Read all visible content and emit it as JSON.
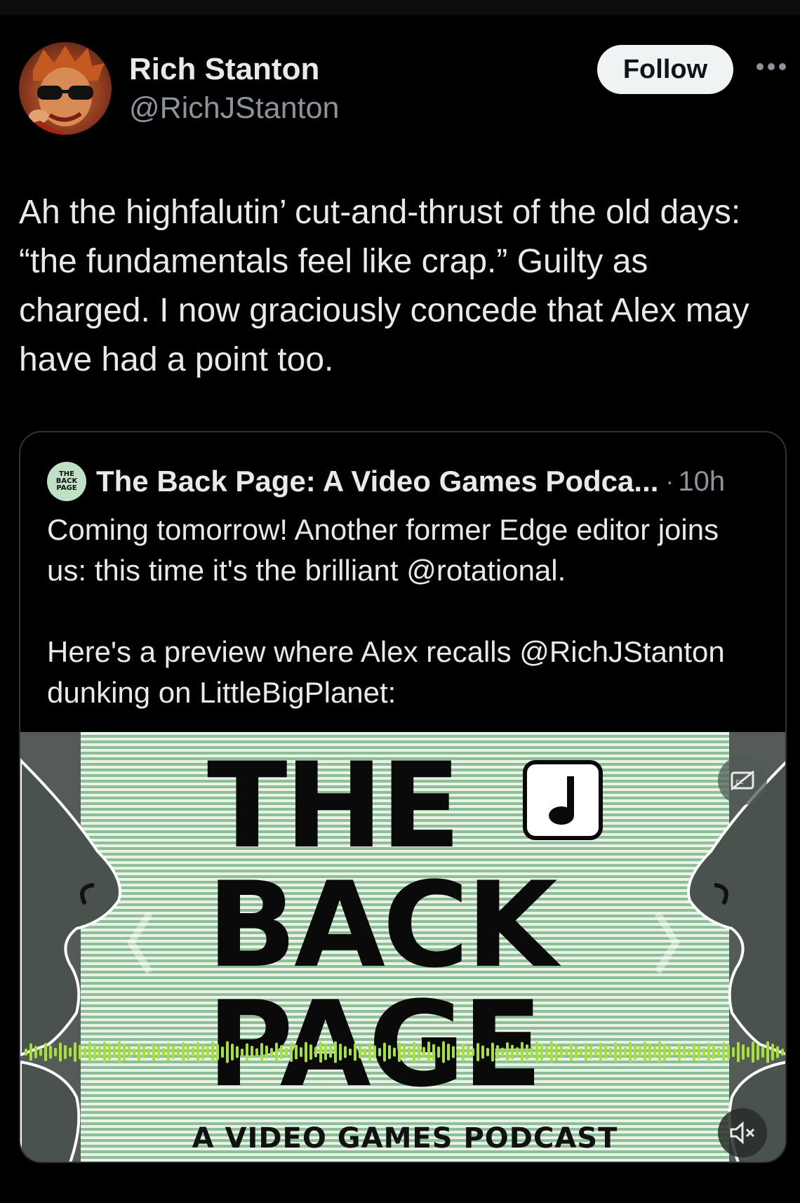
{
  "author": {
    "display_name": "Rich Stanton",
    "handle": "@RichJStanton",
    "avatar_icon": "avatar-photo"
  },
  "actions": {
    "follow_label": "Follow",
    "more_icon": "more-horizontal-icon"
  },
  "tweet": {
    "text": "Ah the highfalutin’ cut-and-thrust of the old days: “the fundamentals feel like crap.” Guilty as charged. I now graciously concede that Alex may have had a point too."
  },
  "quoted_tweet": {
    "logo_lines": [
      "THE",
      "BACK",
      "PAGE"
    ],
    "author_name": "The Back Page: A Video Games Podca...",
    "separator": "·",
    "time": "10h",
    "text": "Coming tomorrow! Another former Edge editor joins us: this time it's the brilliant @rotational.\n\nHere's a preview where Alex recalls @RichJStanton dunking on LittleBigPlanet:",
    "media": {
      "title_lines": [
        "THE",
        "BACK",
        "PAGE"
      ],
      "subtitle": "A VIDEO GAMES PODCAST",
      "captions_icon": "closed-captions-off-icon",
      "mute_icon": "speaker-muted-icon",
      "colors": {
        "stripe_light": "#e8f2e8",
        "stripe_green": "#8fc095",
        "waveform": "#a6e03a",
        "background": "#555c58"
      }
    }
  }
}
